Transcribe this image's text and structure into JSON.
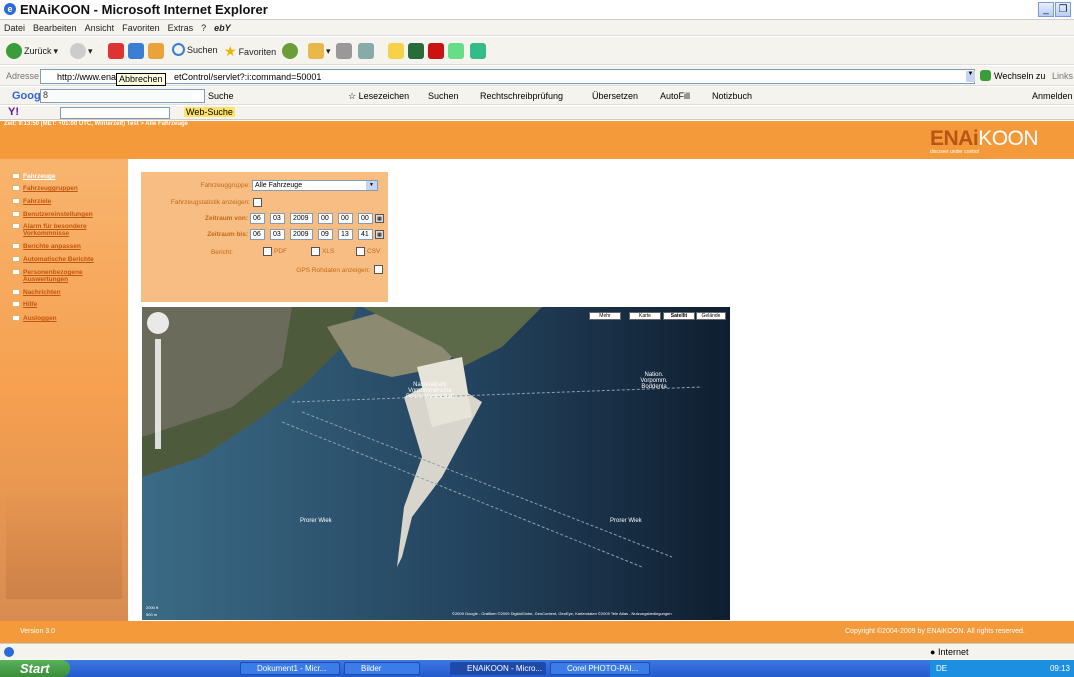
{
  "window": {
    "title": "ENAiKOON - Microsoft Internet Explorer"
  },
  "menubar": {
    "items": [
      "Datei",
      "Bearbeiten",
      "Ansicht",
      "Favoriten",
      "Extras",
      "?"
    ],
    "ebay": "ebY"
  },
  "toolbar": {
    "back": "Zurück",
    "search": "Suchen",
    "favorites": "Favoriten"
  },
  "address": {
    "label": "Adresse",
    "url_prefix": "http://www.ena",
    "url_suffix": "etControl/servlet?:i:command=50001",
    "tooltip": "Abbrechen",
    "go": "Wechseln zu",
    "links": "Links"
  },
  "google_bar": {
    "label": "Google",
    "input": "8",
    "search": "Suche",
    "bookmarks": "Lesezeichen",
    "search2": "Suchen",
    "spell": "Rechtschreibprüfung",
    "translate": "Übersetzen",
    "autofill": "AutoFill",
    "notes": "Notizbuch",
    "signin": "Anmelden"
  },
  "yahoo_bar": {
    "label": "Y!",
    "websearch": "Web-Suche"
  },
  "page": {
    "timestamp": "Zeit: 9:13:50 (MET: +01:00 UTC, Winterzeit) Test > Alle Fahrzeuge",
    "logo_bold": "ENAi",
    "logo_light": "KOON",
    "logo_tag": "discover under control",
    "nav": [
      "Fahrzeuge",
      "Fahrzeuggruppen",
      "Fahrziele",
      "Benutzereinstellungen",
      "Alarm für besondere Vorkommnisse",
      "Berichte anpassen",
      "Automatische Berichte",
      "Personenbezogene Auswertungen",
      "Nachrichten",
      "Hilfe",
      "Ausloggen"
    ],
    "form": {
      "group_label": "Fahrzeuggruppe:",
      "group_value": "Alle Fahrzeuge",
      "stats_label": "Fahrzeugstatistik anzeigen:",
      "from_label": "Zeitraum von:",
      "from": [
        "06",
        "03",
        "2009",
        "00",
        "00",
        "00"
      ],
      "to_label": "Zeitraum bis:",
      "to": [
        "06",
        "03",
        "2009",
        "09",
        "13",
        "41"
      ],
      "report_label": "Bericht:",
      "pdf": "PDF",
      "xls": "XLS",
      "csv": "CSV",
      "gps_label": "GPS Rohdaten anzeigen:"
    },
    "map": {
      "buttons": [
        "Mehr",
        "Karte",
        "Satellit",
        "Gelände"
      ],
      "labels": [
        "Nationalpark Vorpommersche Boddenlandschaft",
        "Nation. Vorpomm. Boddenla",
        "Prorer Wiek",
        "Prorer Wiek"
      ],
      "scale_top": "2000 ft",
      "scale_bottom": "500 m",
      "copyright": "©2009 Google - Grafiken ©2009 DigitalGlobe, GeoContent, GeoEye, Kartendaten ©2009 Tele Atlas - Nutzungsbedingungen"
    },
    "footer": {
      "version": "Version 3.0",
      "copyright": "Copyright ©2004-2009 by ENAiKOON. All rights reserved."
    }
  },
  "status": {
    "zone": "Internet"
  },
  "taskbar": {
    "start": "Start",
    "tasks": [
      "Dokument1 - Micr...",
      "Bilder",
      "ENAiKOON - Micro...",
      "Corel PHOTO-PAI..."
    ],
    "tray": "DE",
    "clock": "09:13"
  }
}
